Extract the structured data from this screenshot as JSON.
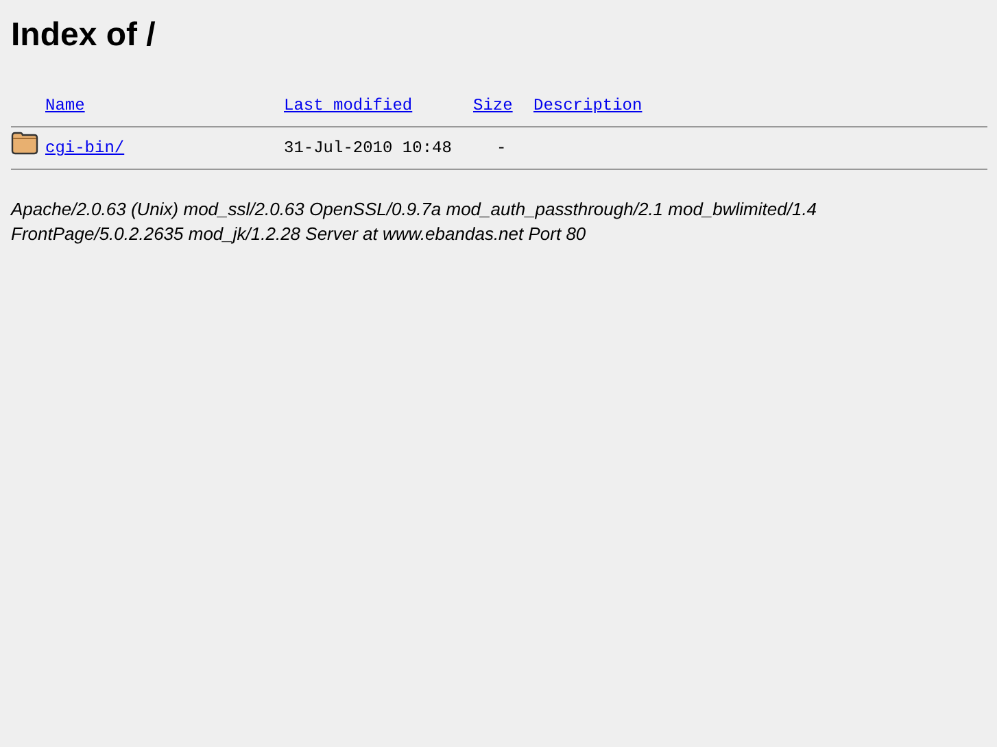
{
  "title": "Index of /",
  "columns": [
    "Name",
    "Last modified",
    "Size",
    "Description"
  ],
  "rows": [
    {
      "kind": "folder",
      "name": "cgi-bin/",
      "modified": "31-Jul-2010 10:48",
      "size": "-"
    }
  ],
  "address": "Apache/2.0.63 (Unix) mod_ssl/2.0.63 OpenSSL/0.9.7a mod_auth_passthrough/2.1 mod_bwlimited/1.4 FrontPage/5.0.2.2635 mod_jk/1.2.28 Server at www.ebandas.net Port 80"
}
